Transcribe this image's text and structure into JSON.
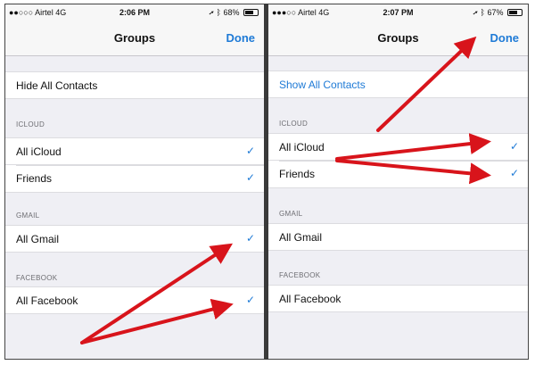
{
  "left": {
    "status": {
      "carrier": "●●○○○ Airtel  4G",
      "time": "2:06 PM",
      "battery": "68%",
      "battery_level": 0.68
    },
    "nav": {
      "title": "Groups",
      "done": "Done"
    },
    "hide_all": "Hide All Contacts",
    "icloud": {
      "header": "ICLOUD",
      "items": [
        "All iCloud",
        "Friends"
      ]
    },
    "gmail": {
      "header": "GMAIL",
      "items": [
        "All Gmail"
      ]
    },
    "facebook": {
      "header": "FACEBOOK",
      "items": [
        "All Facebook"
      ]
    },
    "check_glyph": "✓"
  },
  "right": {
    "status": {
      "carrier": "●●●○○ Airtel  4G",
      "time": "2:07 PM",
      "battery": "67%",
      "battery_level": 0.67
    },
    "nav": {
      "title": "Groups",
      "done": "Done"
    },
    "show_all": "Show All Contacts",
    "icloud": {
      "header": "ICLOUD",
      "items": [
        "All iCloud",
        "Friends"
      ]
    },
    "gmail": {
      "header": "GMAIL",
      "items": [
        "All Gmail"
      ]
    },
    "facebook": {
      "header": "FACEBOOK",
      "items": [
        "All Facebook"
      ]
    },
    "check_glyph": "✓"
  },
  "colors": {
    "accent": "#1e7ad6",
    "arrow": "#d8141b",
    "background": "#efeff4"
  },
  "icons": {
    "arrows": "red-annotation-arrows",
    "bluetooth": "bluetooth-icon",
    "location": "location-arrow-icon"
  }
}
